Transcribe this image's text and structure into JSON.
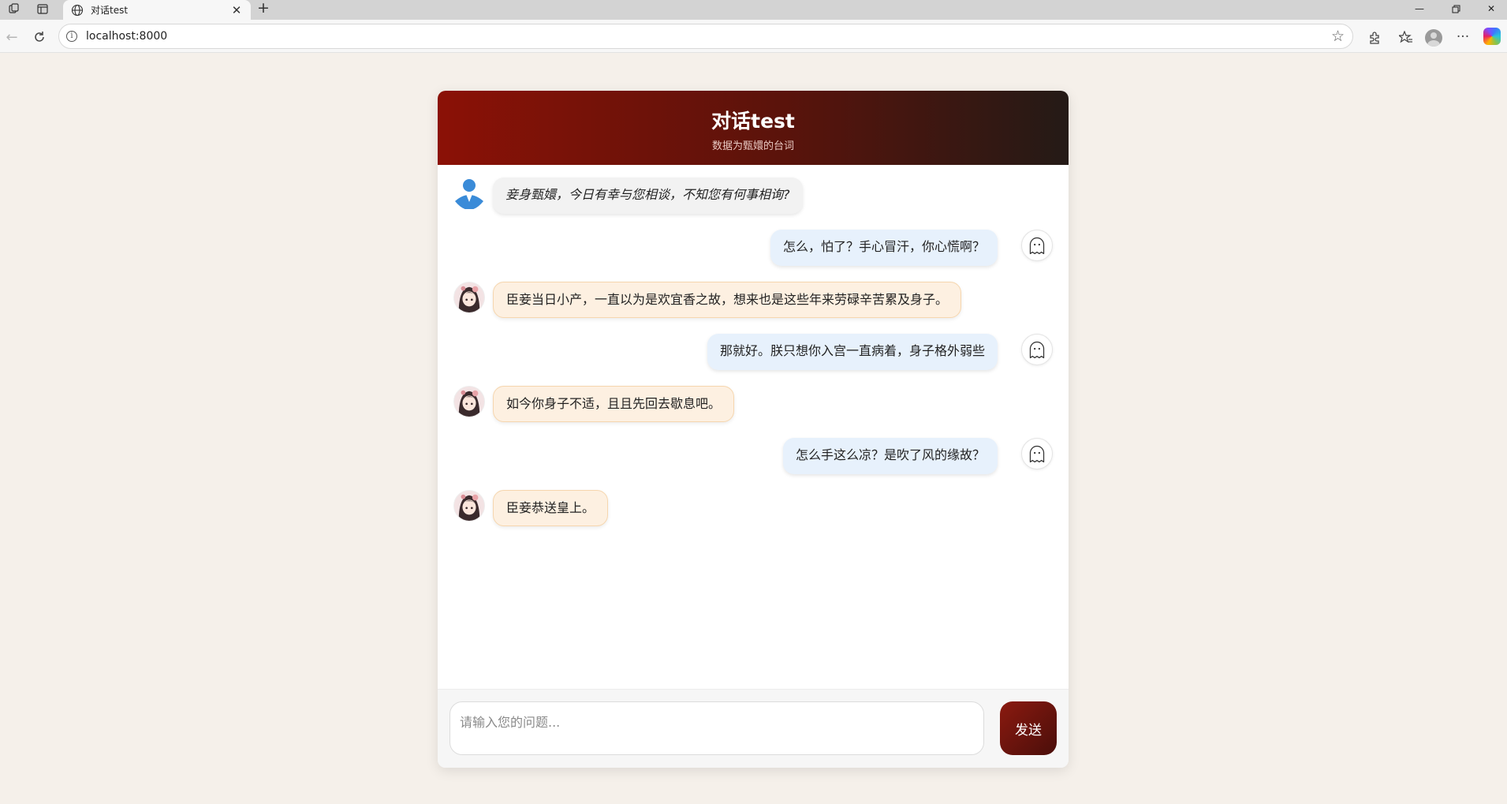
{
  "browser": {
    "tab_title": "对话test",
    "url": "localhost:8000"
  },
  "chat": {
    "title": "对话test",
    "subtitle": "数据为甄嬛的台词",
    "messages": [
      {
        "role": "bot",
        "text": "妾身甄嬛，今日有幸与您相谈，不知您有何事相询?"
      },
      {
        "role": "user",
        "text": "怎么，怕了？手心冒汗，你心慌啊？"
      },
      {
        "role": "bot",
        "text": "臣妾当日小产，一直以为是欢宜香之故，想来也是这些年来劳碌辛苦累及身子。"
      },
      {
        "role": "user",
        "text": "那就好。朕只想你入宫一直病着，身子格外弱些"
      },
      {
        "role": "bot",
        "text": "如今你身子不适，且且先回去歇息吧。"
      },
      {
        "role": "user",
        "text": "怎么手这么凉？是吹了风的缘故？"
      },
      {
        "role": "bot",
        "text": "臣妾恭送皇上。"
      }
    ],
    "input_placeholder": "请输入您的问题...",
    "input_value": "",
    "send_label": "发送"
  },
  "colors": {
    "page_bg": "#f5f0ea",
    "header_gradient_start": "#8b1106",
    "header_gradient_end": "#241a16",
    "user_bubble": "#e7f1fc",
    "bot_bubble": "#fdf0e1",
    "send_button": "#6e1510"
  },
  "icons": {
    "bot_first_avatar": "person-icon",
    "user_avatar": "ghost-icon",
    "bot_avatar": "anime-girl-avatar"
  }
}
